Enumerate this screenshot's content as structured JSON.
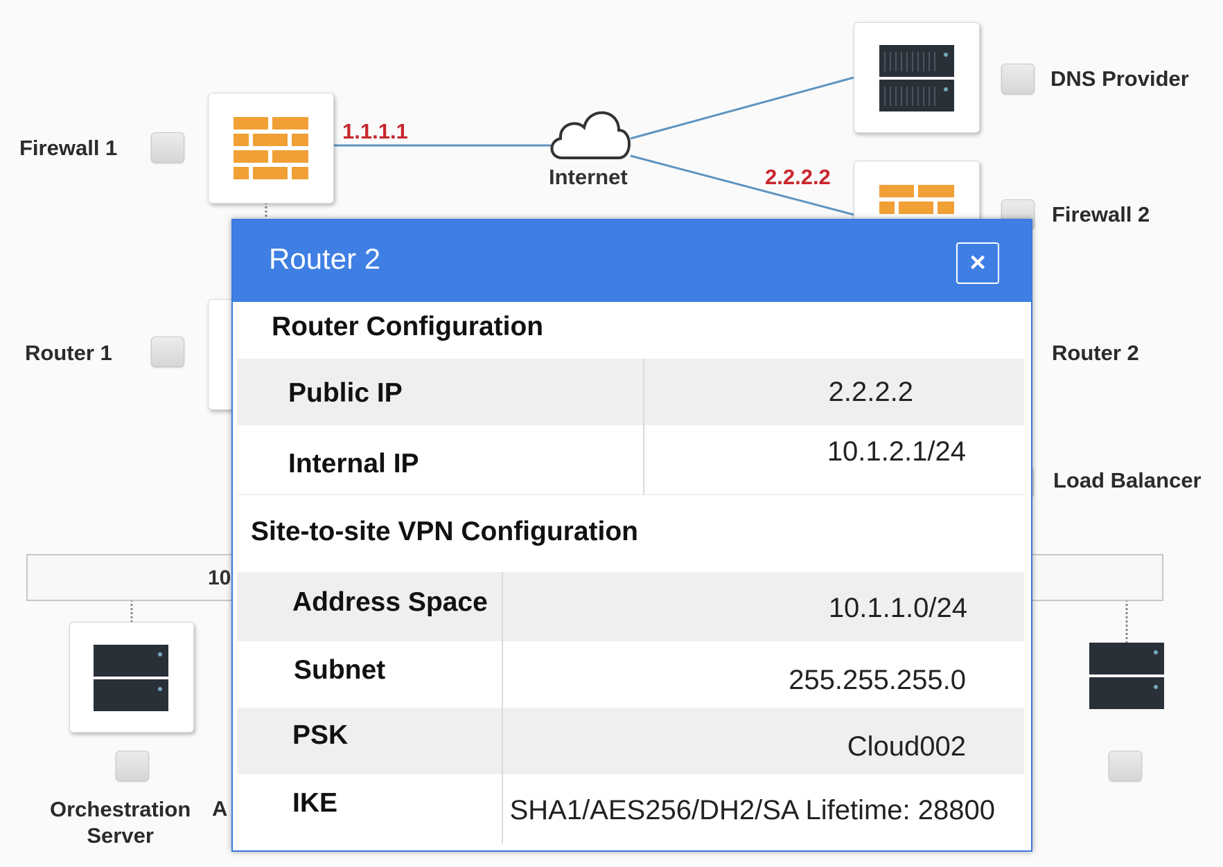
{
  "diagram": {
    "nodes": {
      "firewall1": "Firewall 1",
      "router1": "Router 1",
      "dns_provider": "DNS Provider",
      "firewall2": "Firewall 2",
      "router2": "Router 2",
      "load_balancer": "Load Balancer",
      "orchestration_server": "Orchestration\nServer",
      "app_partial": "A"
    },
    "internet_label": "Internet",
    "ip_firewall1": "1.1.1.1",
    "ip_firewall2": "2.2.2.2",
    "subnet_bar_partial": "10",
    "colors": {
      "accent": "#3f7fe4",
      "ip_text": "#c8272d",
      "firewall": "#f0a035",
      "link": "#5f94bf"
    }
  },
  "modal": {
    "title": "Router 2",
    "close_icon": "close-icon",
    "router_config": {
      "heading": "Router Configuration",
      "rows": [
        {
          "key": "Public IP",
          "value": "2.2.2.2"
        },
        {
          "key": "Internal IP",
          "value": "10.1.2.1/24"
        }
      ]
    },
    "vpn_config": {
      "heading": "Site-to-site VPN Configuration",
      "rows": [
        {
          "key": "Address Space",
          "value": "10.1.1.0/24"
        },
        {
          "key": "Subnet",
          "value": "255.255.255.0"
        },
        {
          "key": "PSK",
          "value": "Cloud002"
        },
        {
          "key": "IKE",
          "value": "SHA1/AES256/DH2/SA Lifetime: 28800"
        }
      ]
    }
  }
}
